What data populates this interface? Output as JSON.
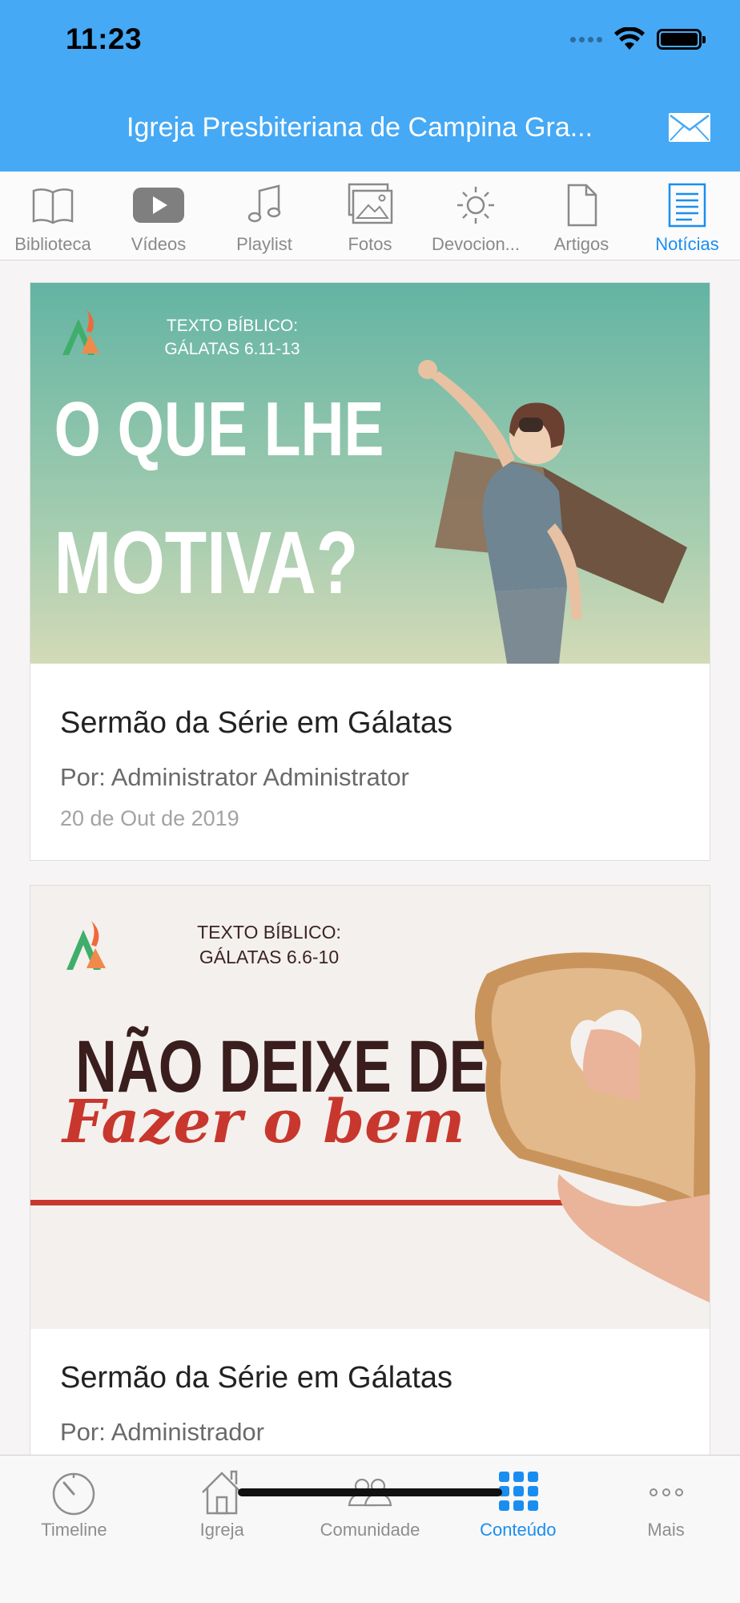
{
  "status": {
    "time": "11:23"
  },
  "header": {
    "title": "Igreja Presbiteriana de Campina Gra...",
    "mail_icon": "envelope-icon"
  },
  "categories": [
    {
      "label": "Biblioteca",
      "icon": "book-icon",
      "active": false
    },
    {
      "label": "Vídeos",
      "icon": "play-icon",
      "active": false
    },
    {
      "label": "Playlist",
      "icon": "music-note-icon",
      "active": false
    },
    {
      "label": "Fotos",
      "icon": "photos-icon",
      "active": false
    },
    {
      "label": "Devocion...",
      "icon": "sun-icon",
      "active": false
    },
    {
      "label": "Artigos",
      "icon": "document-icon",
      "active": false
    },
    {
      "label": "Notícias",
      "icon": "news-icon",
      "active": true
    }
  ],
  "posts": [
    {
      "image": {
        "ref_line1": "TEXTO BÍBLICO:",
        "ref_line2": "GÁLATAS 6.11-13",
        "headline_line1": "O QUE LHE",
        "headline_line2": "MOTIVA?"
      },
      "title": "Sermão da Série em Gálatas",
      "author": "Por: Administrator Administrator",
      "date": "20 de Out de 2019"
    },
    {
      "image": {
        "ref_line1": "TEXTO BÍBLICO:",
        "ref_line2": "GÁLATAS 6.6-10",
        "headline_line1": "NÃO DEIXE DE",
        "headline_line2": "Fazer o bem"
      },
      "title": "Sermão da Série em Gálatas",
      "author": "Por: Administrador"
    }
  ],
  "tabbar": [
    {
      "label": "Timeline",
      "icon": "timeline-icon",
      "active": false
    },
    {
      "label": "Igreja",
      "icon": "church-icon",
      "active": false
    },
    {
      "label": "Comunidade",
      "icon": "community-icon",
      "active": false
    },
    {
      "label": "Conteúdo",
      "icon": "grid-icon",
      "active": true
    },
    {
      "label": "Mais",
      "icon": "more-icon",
      "active": false
    }
  ],
  "colors": {
    "accent": "#1a8ef0",
    "header": "#45a9f5"
  }
}
